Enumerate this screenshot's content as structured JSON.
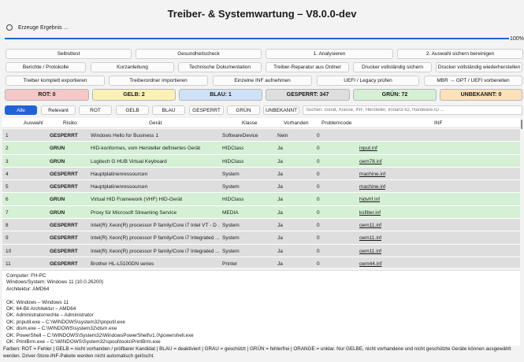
{
  "title": "Treiber- & Systemwartung – V8.0.0-dev",
  "status": {
    "text": "Erzeuge Ergebnis ...",
    "progress_percent": 100,
    "progress_label": "100%"
  },
  "buttons": {
    "row1": [
      "Selbsttest",
      "Gesundheitscheck",
      "1. Analysieren",
      "2. Auswahl sichern  bereinigen"
    ],
    "row2": [
      "Berichte / Protokolle",
      "Kurzanleitung",
      "Technische Dokumentation",
      "Treiber-Reparatur aus Ordner",
      "Drucker vollständig sichern",
      "Drucker vollständig wiederherstellen"
    ],
    "row3": [
      "Treiber komplett exportieren",
      "Treiberordner importieren",
      "Einzelne INF aufnehmen",
      "UEFI / Legacy prüfen",
      "MBR → GPT / UEFI vorbereiten"
    ]
  },
  "summary": {
    "rot": "ROT: 0",
    "gelb": "GELB: 2",
    "blau": "BLAU: 1",
    "gesperrt": "GESPERRT: 347",
    "gruen": "GRÜN: 72",
    "unbekannt": "UNBEKANNT: 0",
    "colors": {
      "rot": "#f6c7c7",
      "gelb": "#fbf1b5",
      "blau": "#cfe1f6",
      "gesperrt": "#dedede",
      "gruen": "#d5f0d5",
      "unbekannt": "#fde1b8"
    }
  },
  "filters": [
    "Alle",
    "Relevant",
    "ROT",
    "GELB",
    "BLAU",
    "GESPERRT",
    "GRÜN",
    "UNBEKANNT"
  ],
  "search_placeholder": "Suchen: Gerät, Klasse, INF, Hersteller, Instanz-ID, Hardware-ID ...",
  "table": {
    "columns": [
      "Auswahl",
      "Risiko",
      "Gerät",
      "Klasse",
      "Vorhanden",
      "Problemcode",
      "INF"
    ],
    "rows": [
      {
        "n": "1",
        "risk": "GESPERRT",
        "device": "Windows Hello for Business 1",
        "class": "SoftwareDevice",
        "present": "Nein",
        "code": "0",
        "inf": ""
      },
      {
        "n": "2",
        "risk": "GRÜN",
        "device": "HID-konformes, vom Hersteller definiertes Gerät",
        "class": "HIDClass",
        "present": "Ja",
        "code": "0",
        "inf": "input.inf"
      },
      {
        "n": "3",
        "risk": "GRÜN",
        "device": "Logitech G HUB Virtual Keyboard",
        "class": "HIDClass",
        "present": "Ja",
        "code": "0",
        "inf": "oem78.inf"
      },
      {
        "n": "4",
        "risk": "GESPERRT",
        "device": "Hauptplatinenressourcen",
        "class": "System",
        "present": "Ja",
        "code": "0",
        "inf": "machine.inf"
      },
      {
        "n": "5",
        "risk": "GESPERRT",
        "device": "Hauptplatinenressourcen",
        "class": "System",
        "present": "Ja",
        "code": "0",
        "inf": "machine.inf"
      },
      {
        "n": "6",
        "risk": "GRÜN",
        "device": "Virtual HID Framework (VHF) HID-Gerät",
        "class": "HIDClass",
        "present": "Ja",
        "code": "0",
        "inf": "hidvhf.inf"
      },
      {
        "n": "7",
        "risk": "GRÜN",
        "device": "Proxy für Microsoft Streaming Service",
        "class": "MEDIA",
        "present": "Ja",
        "code": "0",
        "inf": "ksfilter.inf"
      },
      {
        "n": "8",
        "risk": "GESPERRT",
        "device": "Intel(R) Xeon(R) processor P family/Core i7 Intel VT - D ...",
        "class": "System",
        "present": "Ja",
        "code": "0",
        "inf": "oem11.inf"
      },
      {
        "n": "9",
        "risk": "GESPERRT",
        "device": "Intel(R) Xeon(R) processor P family/Core i7 Integrated ...",
        "class": "System",
        "present": "Ja",
        "code": "0",
        "inf": "oem11.inf"
      },
      {
        "n": "10",
        "risk": "GESPERRT",
        "device": "Intel(R) Xeon(R) processor P family/Core i7 Integrated ...",
        "class": "System",
        "present": "Ja",
        "code": "0",
        "inf": "oem11.inf"
      },
      {
        "n": "11",
        "risk": "GESPERRT",
        "device": "Brother HL-L5100DN series",
        "class": "Printer",
        "present": "Ja",
        "code": "0",
        "inf": "oem44.inf"
      }
    ]
  },
  "log": [
    "Computer: FH-PC",
    "Windows/System: Windows 11 (10.0.26200)",
    "Architektur: AMD64",
    "",
    "OK: Windows – Windows 11",
    "OK: 64-Bit Architektur – AMD64",
    "OK: Administratorrechte – Administrator",
    "OK: pnputil.exe – C:\\WINDOWS\\system32\\pnputil.exe",
    "OK: dism.exe – C:\\WINDOWS\\system32\\dism.exe",
    "OK: PowerShell – C:\\WINDOWS\\System32\\WindowsPowerShell\\v1.0\\powershell.exe",
    "OK: PrintBrm.exe – C:\\WINDOWS\\System32\\spool\\tools\\PrintBrm.exe"
  ],
  "footer": "Farben: ROT = Fehler | GELB = nicht vorhanden / prüfbarer Kandidat | BLAU = deaktiviert | GRAU = geschützt | GRÜN = fehlerfrei | ORANGE = unklar. Nur GELBE, nicht vorhandene und nicht geschützte Geräte können ausgewählt werden. Driver-Store-INF-Pakete werden nicht automatisch gelöscht."
}
